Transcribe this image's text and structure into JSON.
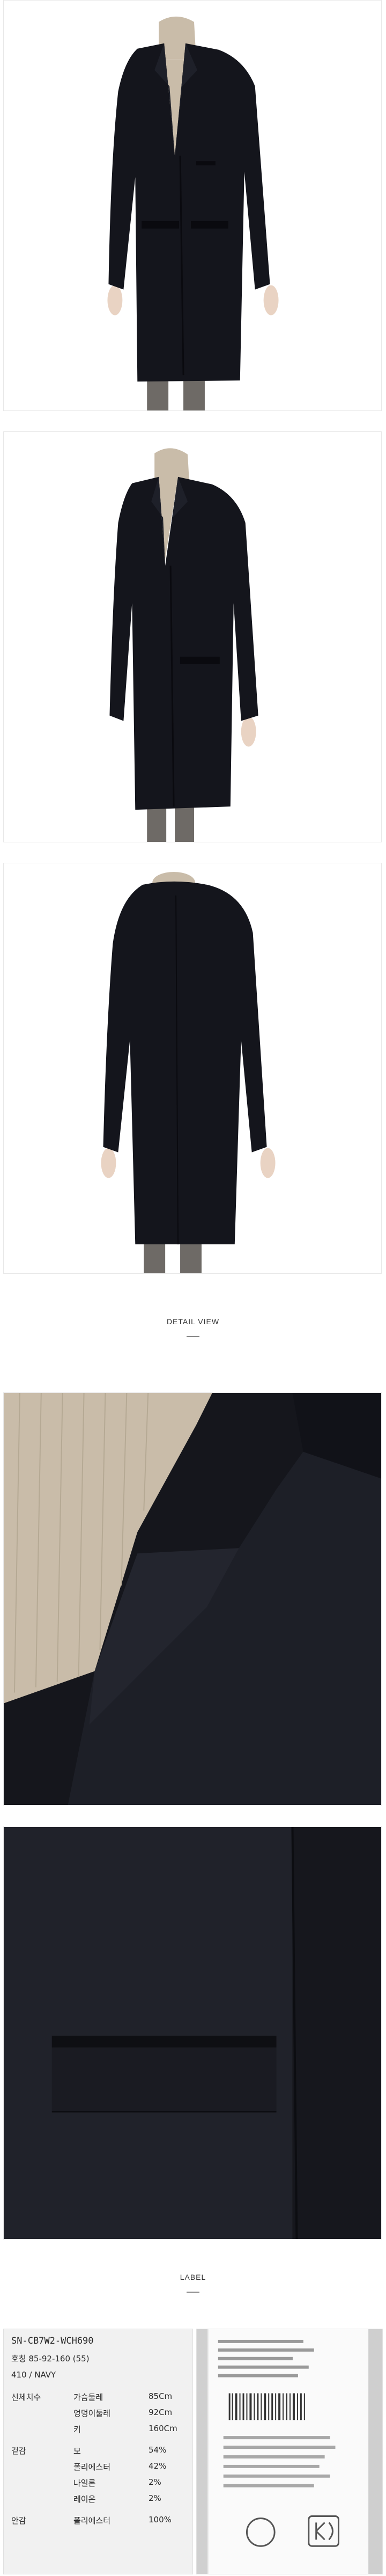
{
  "sections": {
    "detail_title": "DETAIL VIEW",
    "label_title": "LABEL"
  },
  "photos": [
    {
      "id": "front",
      "alt": "coat front view"
    },
    {
      "id": "three-quarter",
      "alt": "coat side view"
    },
    {
      "id": "back",
      "alt": "coat back view"
    },
    {
      "id": "detail-collar",
      "alt": "collar detail"
    },
    {
      "id": "detail-pocket",
      "alt": "pocket detail"
    }
  ],
  "label": {
    "code": "SN-CB7W2-WCH690",
    "size_line": "호칭 85-92-160 (55)",
    "color_line": "410 / NAVY",
    "measure_header": "신체치수",
    "rows": [
      {
        "k": "가슴둘레",
        "v": "85Cm"
      },
      {
        "k": "엉덩이둘레",
        "v": "92Cm"
      },
      {
        "k": "키",
        "v": "160Cm"
      }
    ],
    "fabric_header": "겉감",
    "fabric": [
      {
        "k": "모",
        "v": "54%"
      },
      {
        "k": "폴리에스터",
        "v": "42%"
      },
      {
        "k": "나일론",
        "v": "2%"
      },
      {
        "k": "레이온",
        "v": "2%"
      }
    ],
    "lining_header": "안감",
    "lining": {
      "k": "폴리에스터",
      "v": "100%"
    }
  },
  "colors": {
    "coat": "#14151c",
    "coat_shadow": "#0a0a0f",
    "sweater": "#c9bca9",
    "skin": "#e9d3c3",
    "pants": "#6e6a66"
  }
}
